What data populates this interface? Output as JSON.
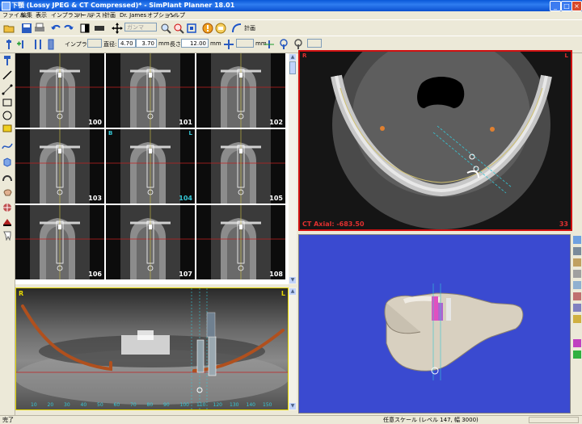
{
  "window": {
    "title": "下顎 (Lossy JPEG & CT Compressed)* - SimPlant Planner 18.01"
  },
  "menu": [
    "ファイル",
    "編集",
    "表示",
    "インプラント",
    "ツール",
    "テスト",
    "計画",
    "Dr. James",
    "オプション",
    "ヘルプ"
  ],
  "toolbar1": {
    "planning_label": "計画",
    "dropdown_value": "ガンマ"
  },
  "toolbar2": {
    "implant_label": "インプラント",
    "implant_value": "",
    "diameter_label": "直径:",
    "diameter_value": "4.70",
    "diameter2_value": "3.70",
    "diameter_unit": "mm",
    "length_label": "長さ",
    "length_value": "12.00",
    "length_unit": "mm",
    "offset_value": "",
    "offset_unit": "mm"
  },
  "cross_sections": {
    "slices": [
      "100",
      "101",
      "102",
      "103",
      "104",
      "105",
      "106",
      "107",
      "108"
    ],
    "selected_slice": "104",
    "selected_left": "B",
    "selected_right": "L"
  },
  "panoramic": {
    "left_label": "R",
    "right_label": "L",
    "ruler": [
      "10",
      "20",
      "30",
      "40",
      "50",
      "60",
      "70",
      "80",
      "90",
      "100",
      "110",
      "120",
      "130",
      "140",
      "150"
    ]
  },
  "axial": {
    "label": "CT Axial: -683.50",
    "slice": "33",
    "left_label": "R",
    "right_label": "L"
  },
  "status": {
    "left": "完了",
    "scale": "任意スケール (レベル 147, 幅 3000)"
  },
  "colors": {
    "axial_border": "#d01010",
    "selection": "#35c7d6",
    "panoramic_border": "#e6d800",
    "nerve": "#b0501e",
    "background_3d": "#3a4ad0"
  }
}
